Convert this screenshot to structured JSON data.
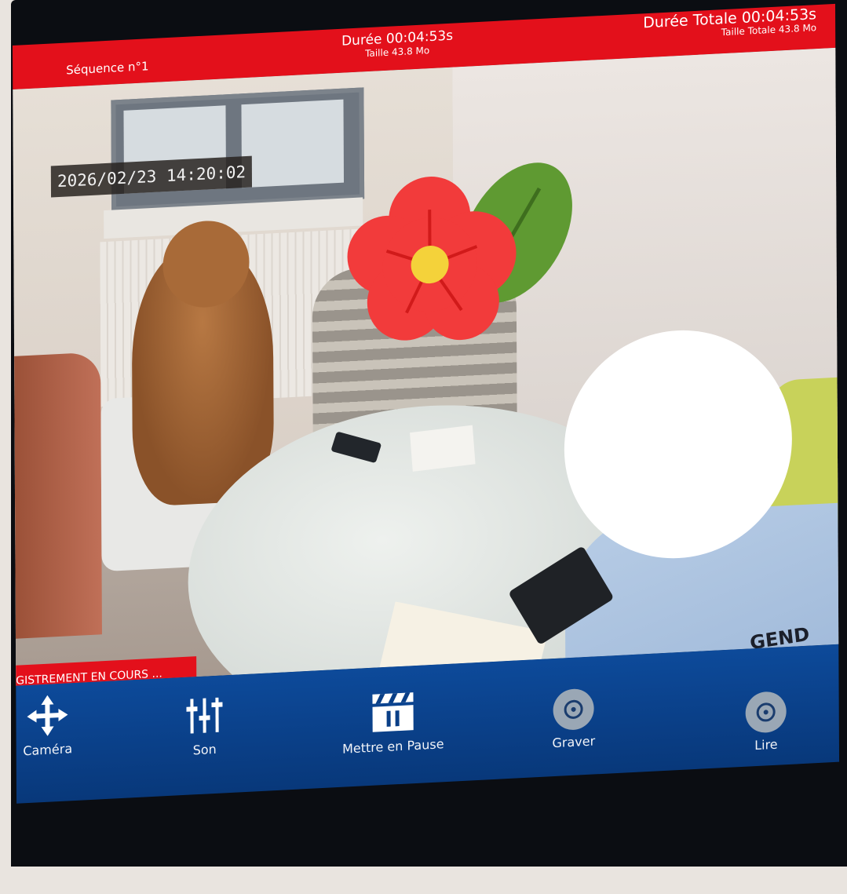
{
  "status_bar": {
    "sequence": "Séquence n°1",
    "duration": "Durée 00:04:53s",
    "size": "Taille 43.8 Mo",
    "total_duration": "Durée Totale 00:04:53s",
    "total_size": "Taille Totale 43.8 Mo"
  },
  "feed": {
    "timestamp": "2026/02/23 14:20:02",
    "recording_banner": "GISTREMENT EN COURS ...",
    "uniform_text": "GEND"
  },
  "toolbar": {
    "items": [
      {
        "label": "Caméra",
        "icon": "move-arrows-icon"
      },
      {
        "label": "Son",
        "icon": "sliders-icon"
      },
      {
        "label": "Mettre en Pause",
        "icon": "pause-clapper-icon"
      },
      {
        "label": "Graver",
        "icon": "burn-disc-icon"
      },
      {
        "label": "Lire",
        "icon": "play-disc-icon"
      }
    ]
  },
  "colors": {
    "status_red": "#e3101b",
    "toolbar_blue": "#0a3f87"
  }
}
